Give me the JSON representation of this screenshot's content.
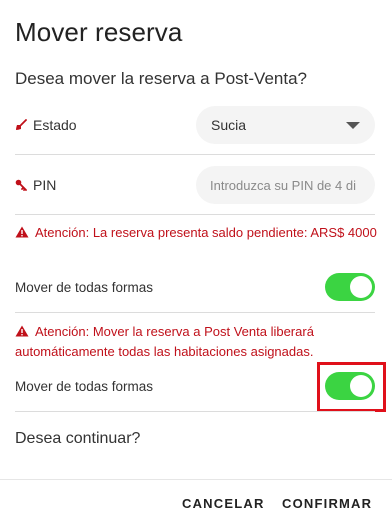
{
  "dialog": {
    "title": "Mover reserva",
    "question": "Desea mover la reserva a Post-Venta?",
    "continue_question": "Desea continuar?"
  },
  "estado": {
    "label": "Estado",
    "icon": "broom-icon",
    "selected": "Sucia"
  },
  "pin": {
    "label": "PIN",
    "icon": "key-icon",
    "value": "",
    "placeholder": "Introduzca su PIN de 4 di"
  },
  "warnings": [
    {
      "text": "Atención: La reserva presenta saldo pendiente: ARS$ 4000",
      "toggle_label": "Mover de todas formas",
      "toggle_on": true
    },
    {
      "text": "Atención: Mover la reserva a Post Venta liberará automáticamente todas las habitaciones asignadas.",
      "toggle_label": "Mover de todas formas",
      "toggle_on": true
    }
  ],
  "actions": {
    "cancel": "CANCELAR",
    "confirm": "CONFIRMAR"
  },
  "colors": {
    "accent_red": "#c0101a",
    "toggle_on": "#3bd442",
    "highlight": "#e0101a"
  }
}
